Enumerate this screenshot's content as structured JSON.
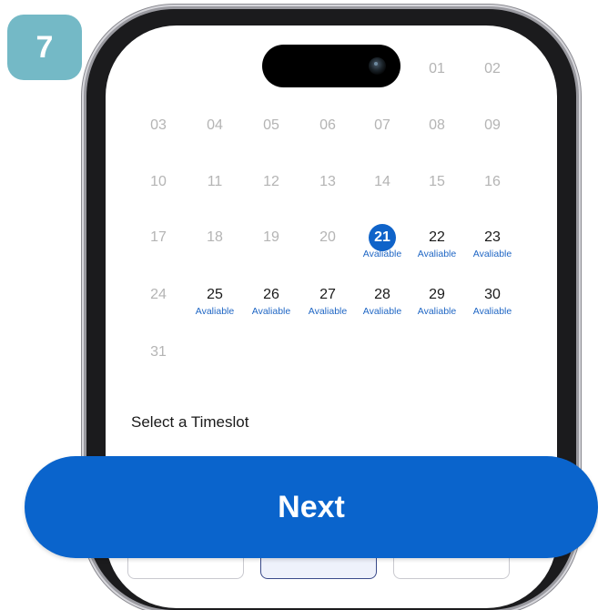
{
  "step": {
    "number": "7"
  },
  "calendar": {
    "rows": [
      [
        {
          "day": "01"
        },
        {
          "day": "02"
        }
      ],
      [
        {
          "day": "03"
        },
        {
          "day": "04"
        },
        {
          "day": "05"
        },
        {
          "day": "06"
        },
        {
          "day": "07"
        },
        {
          "day": "08"
        },
        {
          "day": "09"
        }
      ],
      [
        {
          "day": "10"
        },
        {
          "day": "11"
        },
        {
          "day": "12"
        },
        {
          "day": "13"
        },
        {
          "day": "14"
        },
        {
          "day": "15"
        },
        {
          "day": "16"
        }
      ],
      [
        {
          "day": "17"
        },
        {
          "day": "18"
        },
        {
          "day": "19"
        },
        {
          "day": "20"
        },
        {
          "day": "21",
          "status": "Avaliable",
          "selected": true
        },
        {
          "day": "22",
          "status": "Avaliable"
        },
        {
          "day": "23",
          "status": "Avaliable"
        }
      ],
      [
        {
          "day": "24"
        },
        {
          "day": "25",
          "status": "Avaliable"
        },
        {
          "day": "26",
          "status": "Avaliable"
        },
        {
          "day": "27",
          "status": "Avaliable"
        },
        {
          "day": "28",
          "status": "Avaliable"
        },
        {
          "day": "29",
          "status": "Avaliable"
        },
        {
          "day": "30",
          "status": "Avaliable"
        }
      ],
      [
        {
          "day": "31"
        }
      ]
    ]
  },
  "timeslot": {
    "label": "Select a Timeslot"
  },
  "footer": {
    "next_label": "Next"
  },
  "colors": {
    "accent": "#0a64cc",
    "badge": "#74b9c6",
    "available_text": "#1f66c4"
  }
}
